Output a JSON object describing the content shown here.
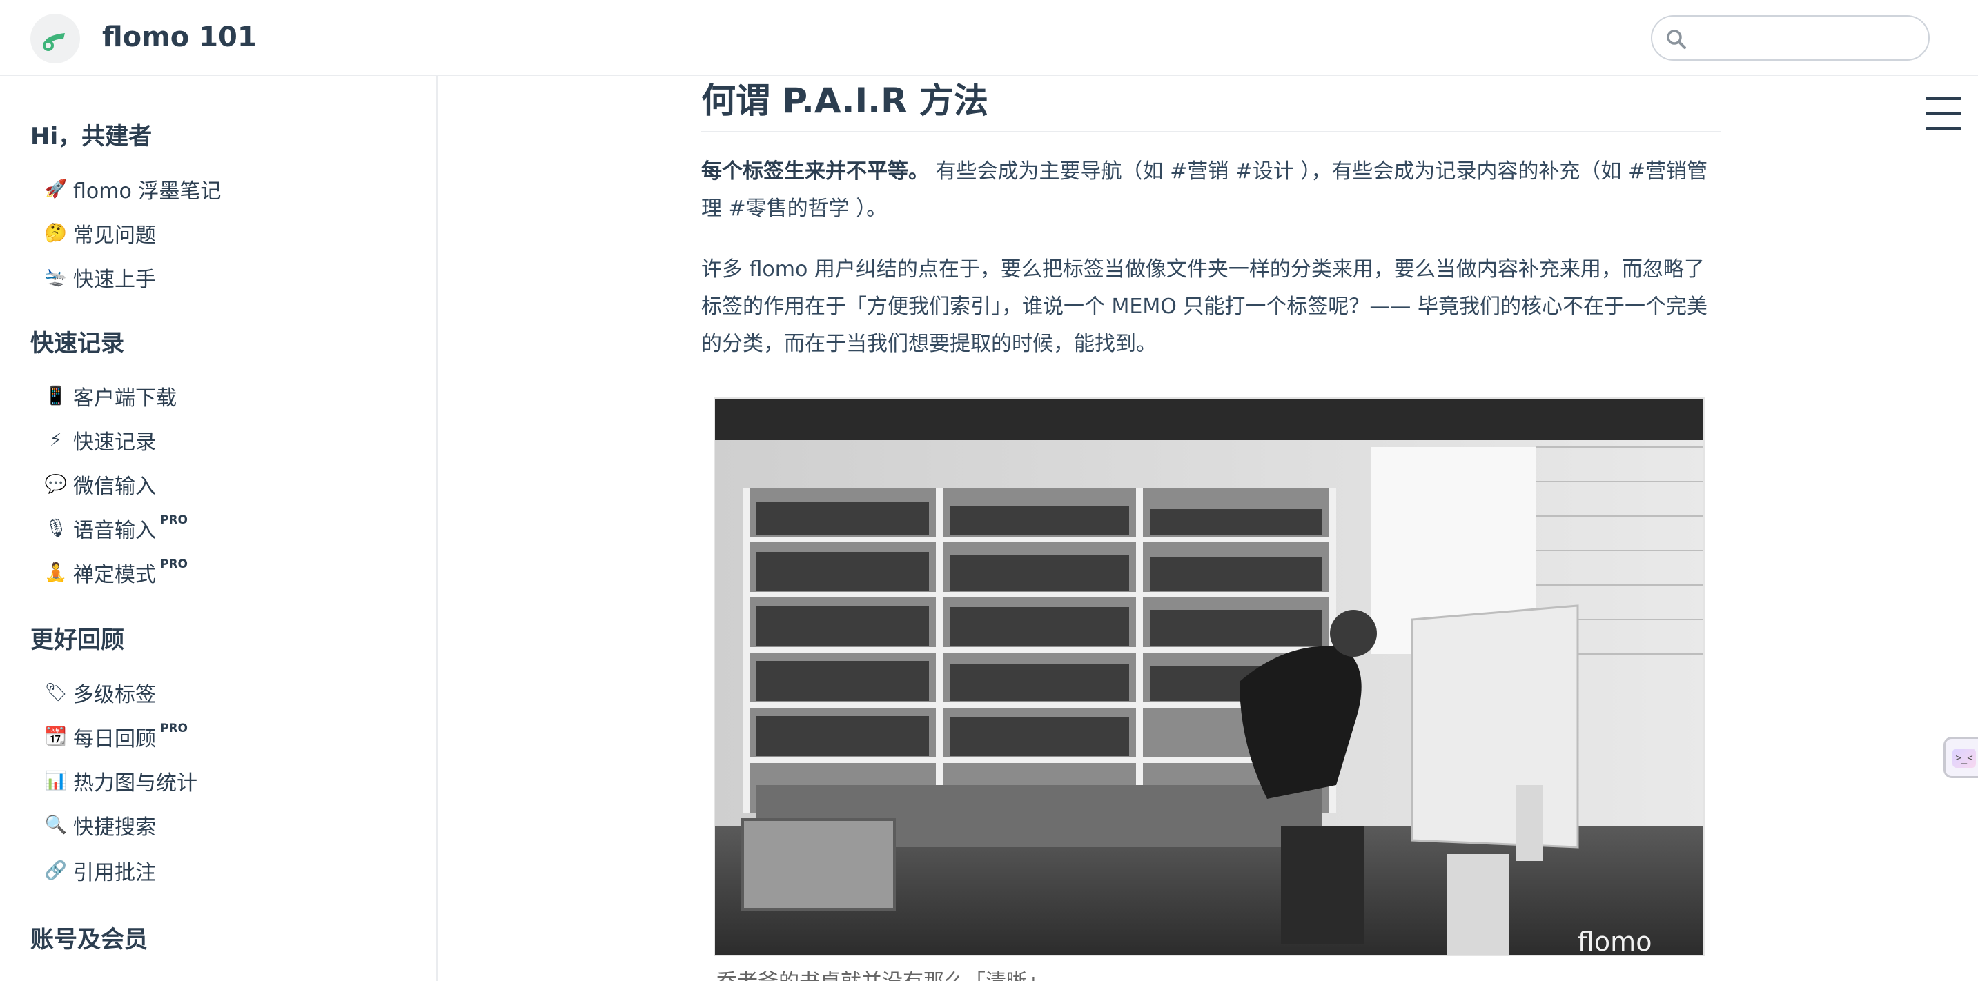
{
  "header": {
    "site_title": "flomo 101",
    "search": {
      "placeholder": "",
      "value": ""
    }
  },
  "sidebar": {
    "groups": [
      {
        "title": "Hi，共建者",
        "items": [
          {
            "emoji": "🚀",
            "label": "flomo 浮墨笔记",
            "pro": ""
          },
          {
            "emoji": "🤔",
            "label": "常见问题",
            "pro": ""
          },
          {
            "emoji": "🛬",
            "label": "快速上手",
            "pro": ""
          }
        ]
      },
      {
        "title": "快速记录",
        "items": [
          {
            "emoji": "📱",
            "label": "客户端下载",
            "pro": ""
          },
          {
            "emoji": "⚡",
            "label": "快速记录",
            "pro": ""
          },
          {
            "emoji": "💬",
            "label": "微信输入",
            "pro": ""
          },
          {
            "emoji": "🎙",
            "label": "语音输入",
            "pro": "PRO"
          },
          {
            "emoji": "🧘",
            "label": "禅定模式",
            "pro": "PRO"
          }
        ]
      },
      {
        "title": "更好回顾",
        "items": [
          {
            "emoji": "🏷",
            "label": "多级标签",
            "pro": ""
          },
          {
            "emoji": "📆",
            "label": "每日回顾",
            "pro": "PRO"
          },
          {
            "emoji": "📊",
            "label": "热力图与统计",
            "pro": ""
          },
          {
            "emoji": "🔍",
            "label": "快捷搜索",
            "pro": ""
          },
          {
            "emoji": "🔗",
            "label": "引用批注",
            "pro": ""
          }
        ]
      },
      {
        "title": "账号及会员",
        "items": []
      }
    ]
  },
  "article": {
    "title": "何谓 P.A.I.R 方法",
    "para1_strong": "每个标签生来并不平等。",
    "para1_rest": " 有些会成为主要导航（如 #营销 #设计 ），有些会成为记录内容的补充（如 #营销管理 #零售的哲学 ）。",
    "para2": "许多 flomo 用户纠结的点在于，要么把标签当做像文件夹一样的分类来用，要么当做内容补充来用，而忽略了标签的作用在于「方便我们索引」，谁说一个 MEMO 只能打一个标签呢？—— 毕竟我们的核心不在于一个完美的分类，而在于当我们想要提取的时候，能找到。",
    "image_watermark": "flomo",
    "caption": "乔老爷的书桌就并没有那么「清晰」"
  },
  "side_widget": {
    "label": ">_<"
  },
  "colors": {
    "text": "#34495e",
    "heading": "#2c3e50",
    "border": "#eaecef",
    "logo_green": "#3eb47a"
  },
  "icons": {
    "logo": "flomo-logo-icon",
    "search": "search-icon",
    "menu": "hamburger-menu-icon"
  }
}
